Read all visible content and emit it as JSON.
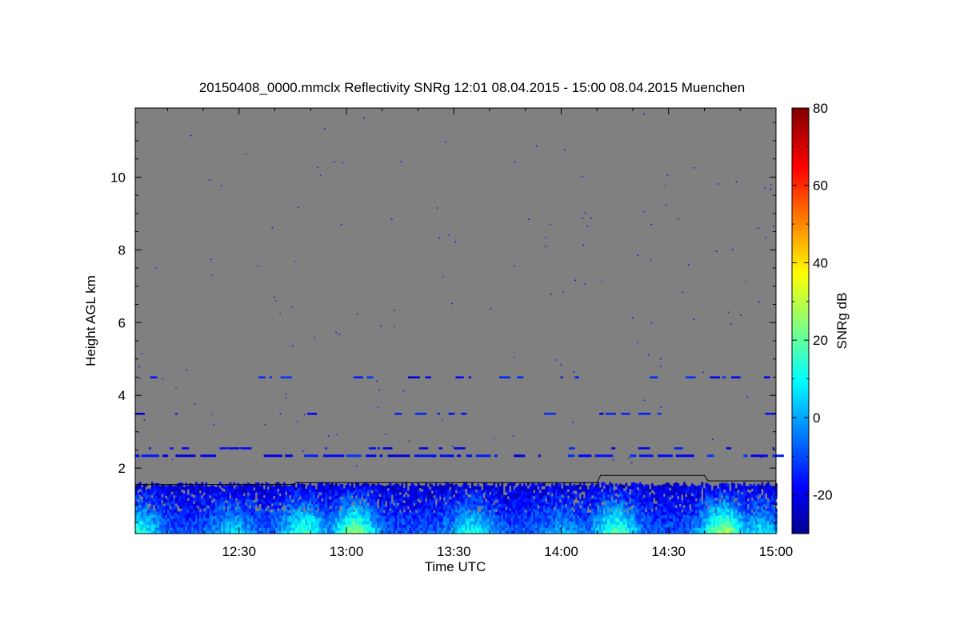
{
  "chart_data": {
    "type": "heatmap",
    "title": "20150408_0000.mmclx Reflectivity SNRg   12:01 08.04.2015 - 15:00 08.04.2015 Muenchen",
    "xlabel": "Time UTC",
    "ylabel": "Height AGL km",
    "x_ticks": [
      "12:30",
      "13:00",
      "13:30",
      "14:00",
      "14:30",
      "15:00"
    ],
    "x_tick_minutes": [
      30,
      60,
      90,
      120,
      150,
      180
    ],
    "xlim_minutes": [
      1,
      180
    ],
    "y_ticks": [
      "2",
      "4",
      "6",
      "8",
      "10"
    ],
    "y_tick_values": [
      2,
      4,
      6,
      8,
      10
    ],
    "ylim": [
      0.2,
      11.9
    ],
    "colorbar": {
      "label": "SNRg dB",
      "ticks": [
        "80",
        "60",
        "40",
        "20",
        "0",
        "-20"
      ],
      "tick_values": [
        80,
        60,
        40,
        20,
        0,
        -20
      ],
      "range": [
        -30,
        80
      ],
      "colormap": "jet"
    },
    "background_color": "#808080",
    "boundary_layer_height_km": [
      {
        "t": 1,
        "h": 1.55
      },
      {
        "t": 45,
        "h": 1.55
      },
      {
        "t": 46,
        "h": 1.6
      },
      {
        "t": 130,
        "h": 1.6
      },
      {
        "t": 131,
        "h": 1.8
      },
      {
        "t": 160,
        "h": 1.8
      },
      {
        "t": 161,
        "h": 1.65
      },
      {
        "t": 180,
        "h": 1.65
      }
    ],
    "clutter_layers_km": [
      4.5,
      3.5,
      2.55,
      2.35
    ],
    "echo_top_km": 1.6
  }
}
